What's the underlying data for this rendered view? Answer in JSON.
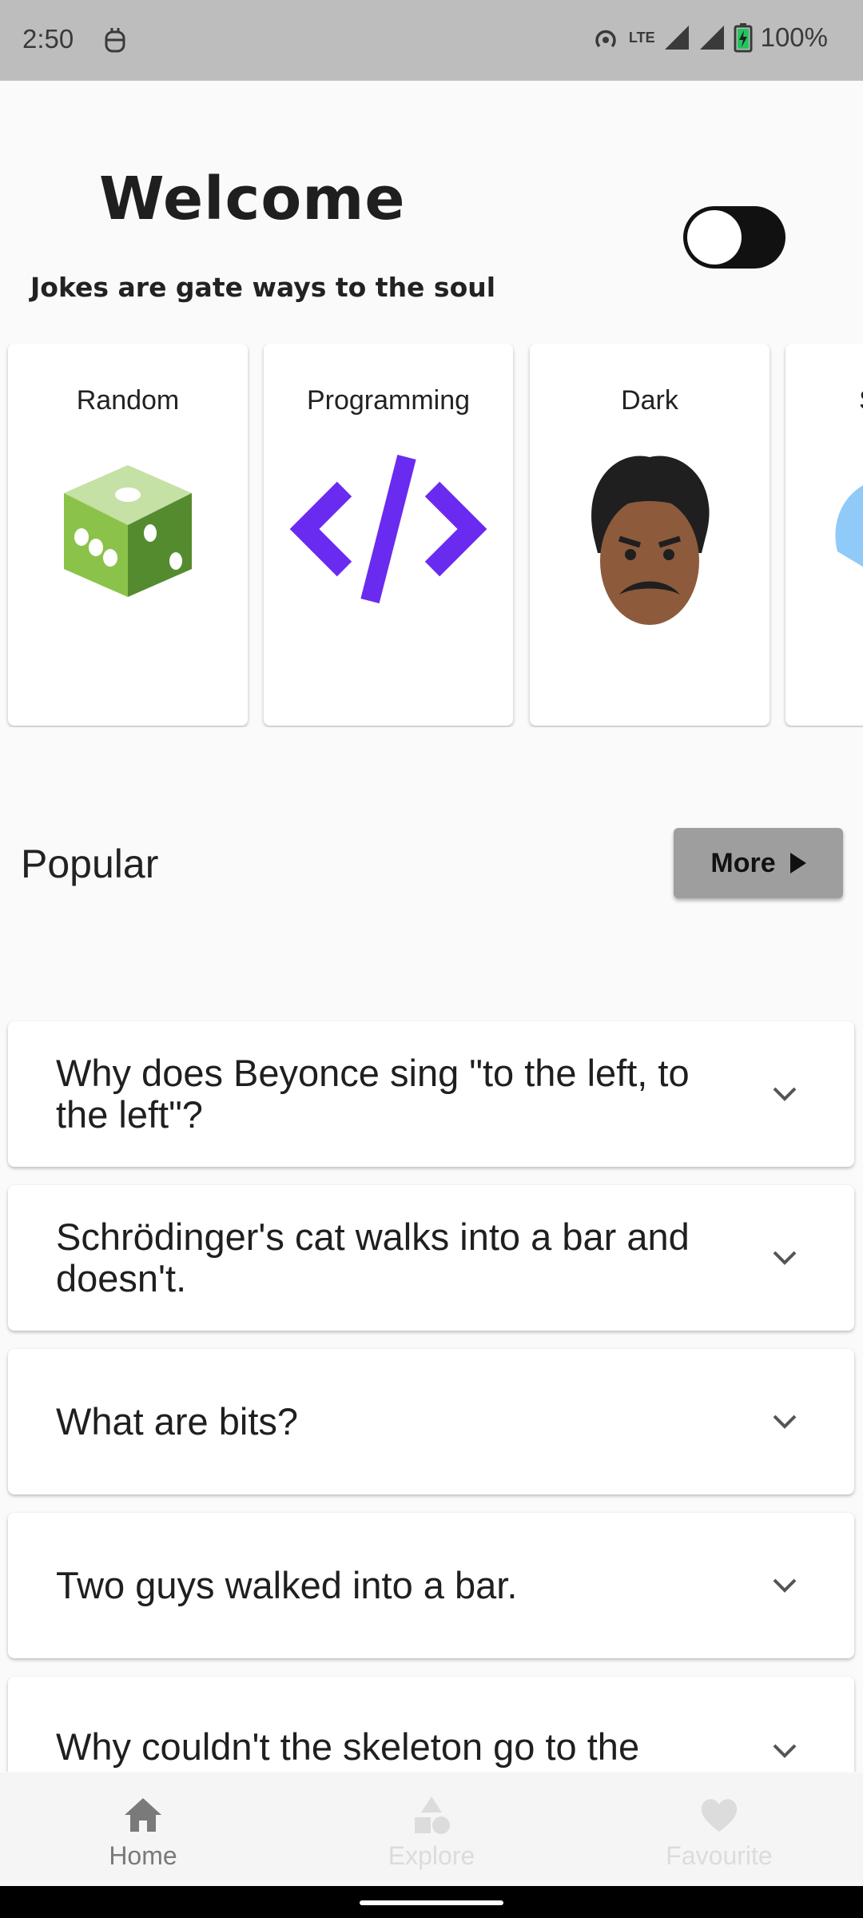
{
  "status_bar": {
    "time": "2:50",
    "network": "LTE",
    "battery": "100%"
  },
  "header": {
    "title": "Welcome",
    "tagline": "Jokes are gate ways to the soul",
    "theme_toggle_on": true
  },
  "categories": [
    {
      "label": "Random",
      "icon": "dice-icon"
    },
    {
      "label": "Programming",
      "icon": "code-icon"
    },
    {
      "label": "Dark",
      "icon": "face-icon"
    },
    {
      "label": "S",
      "icon": "spooky-icon"
    }
  ],
  "popular": {
    "title": "Popular",
    "more_label": "More"
  },
  "jokes": [
    "Why does Beyonce sing \"to the left, to the left\"?",
    "Schrödinger's cat walks into a bar and doesn't.",
    "What are bits?",
    "Two guys walked into a bar.",
    "Why couldn't the skeleton go to the Christmas party?"
  ],
  "nav": {
    "home": "Home",
    "explore": "Explore",
    "favourite": "Favourite"
  },
  "colors": {
    "status_bar_bg": "#bdbdbd",
    "page_bg": "#fafafa",
    "more_button_bg": "#9e9e9e",
    "code_purple": "#6a2bf0",
    "dice_green": "#7cb342"
  }
}
